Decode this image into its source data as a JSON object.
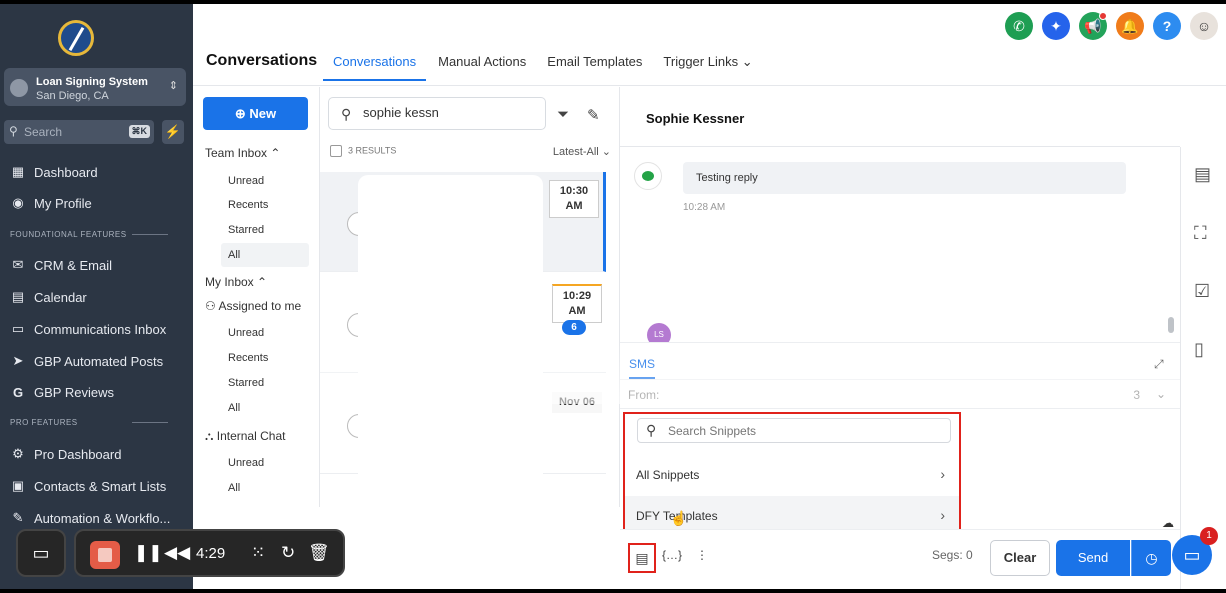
{
  "sidebar": {
    "account_name": "Loan Signing System",
    "account_location": "San Diego, CA",
    "search_placeholder": "Search",
    "search_shortcut": "⌘K",
    "sections": {
      "foundational": "FOUNDATIONAL FEATURES",
      "pro": "PRO FEATURES"
    },
    "nav": {
      "dashboard": "Dashboard",
      "my_profile": "My Profile",
      "crm_email": "CRM & Email",
      "calendar": "Calendar",
      "communications_inbox": "Communications Inbox",
      "gbp_posts": "GBP Automated Posts",
      "gbp_reviews": "GBP Reviews",
      "pro_dashboard": "Pro Dashboard",
      "contacts": "Contacts & Smart Lists",
      "automation": "Automation & Workflo..."
    }
  },
  "recorder": {
    "time": "4:29"
  },
  "header": {
    "page_title": "Conversations",
    "tabs": [
      "Conversations",
      "Manual Actions",
      "Email Templates",
      "Trigger Links"
    ],
    "icon_colors": {
      "phone": "#1e9e53",
      "ai": "#2563eb",
      "megaphone": "#23a35a",
      "bell": "#f07c1a",
      "help": "#2d8cf0"
    }
  },
  "filters": {
    "new_label": "New",
    "team_inbox": "Team Inbox",
    "team_items": [
      "Unread",
      "Recents",
      "Starred",
      "All"
    ],
    "my_inbox": "My Inbox",
    "assigned": "Assigned to me",
    "my_items": [
      "Unread",
      "Recents",
      "Starred",
      "All"
    ],
    "internal_chat": "Internal Chat",
    "internal_items": [
      "Unread",
      "All"
    ]
  },
  "conversations": {
    "search_value": "sophie kessn",
    "results_label": "3 RESULTS",
    "sort_label": "Latest-All",
    "items": [
      {
        "time_line1": "10:30",
        "time_line2": "AM"
      },
      {
        "time_line1": "10:29",
        "time_line2": "AM",
        "unread": "6"
      },
      {
        "time_line1": "Nov 06"
      }
    ]
  },
  "chat": {
    "contact_name": "Sophie Kessner",
    "message_text": "Testing reply",
    "message_time": "10:28 AM",
    "avatar_initials": "LS",
    "composer_tab": "SMS",
    "from_label": "From:",
    "from_value_tail": "3",
    "segs_label": "Segs: 0",
    "clear_label": "Clear",
    "send_label": "Send"
  },
  "snippets": {
    "search_placeholder": "Search Snippets",
    "items": [
      "All Snippets",
      "DFY Templates"
    ]
  },
  "notifications": {
    "chat_badge": "1"
  },
  "colors": {
    "primary": "#1a73e8",
    "highlight": "#e0221b",
    "sidebar_bg": "#2c3644"
  }
}
